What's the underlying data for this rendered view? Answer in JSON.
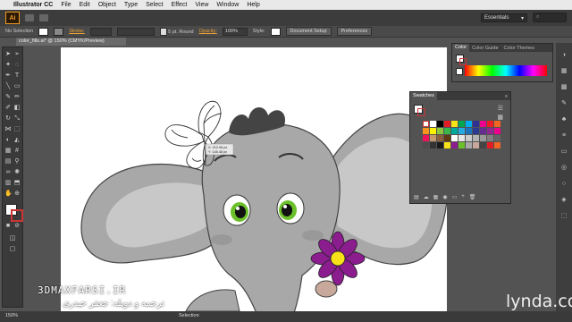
{
  "menubar": {
    "app_name": "Illustrator CC",
    "items": [
      "File",
      "Edit",
      "Object",
      "Type",
      "Select",
      "Effect",
      "View",
      "Window",
      "Help"
    ]
  },
  "appbar": {
    "logo": "Ai",
    "workspace": "Essentials"
  },
  "controlbar": {
    "selection": "No Selection",
    "stroke_label": "Stroke:",
    "stroke_weight": "5 pt. Round",
    "opacity_label": "Opacity:",
    "opacity_value": "100%",
    "style_label": "Style:",
    "document_setup": "Document Setup",
    "preferences": "Preferences"
  },
  "document_tab": "color_fills.ai* @ 150% (CMYK/Preview)",
  "tooltip": {
    "line1": "X: 212.06 px",
    "line2": "Y: 148.48 px"
  },
  "color_panel": {
    "tabs": [
      "Color",
      "Color Guide",
      "Color Themes"
    ]
  },
  "swatches_panel": {
    "title": "Swatches"
  },
  "statusbar": {
    "zoom": "150%",
    "mode": "Selection"
  },
  "watermark": {
    "site": "3DMAXFARSI.IR",
    "caption": "ترجمه و دوبله: جعفر حیدری"
  },
  "brand": "lynda.com",
  "colors": {
    "accent": "#f09a22",
    "elephant": "#a8a8a8",
    "elephant_dark": "#7a7a7a",
    "flower": "#8b1d8f",
    "flower_center": "#f7e21a",
    "eye_green": "#6cc12a"
  }
}
